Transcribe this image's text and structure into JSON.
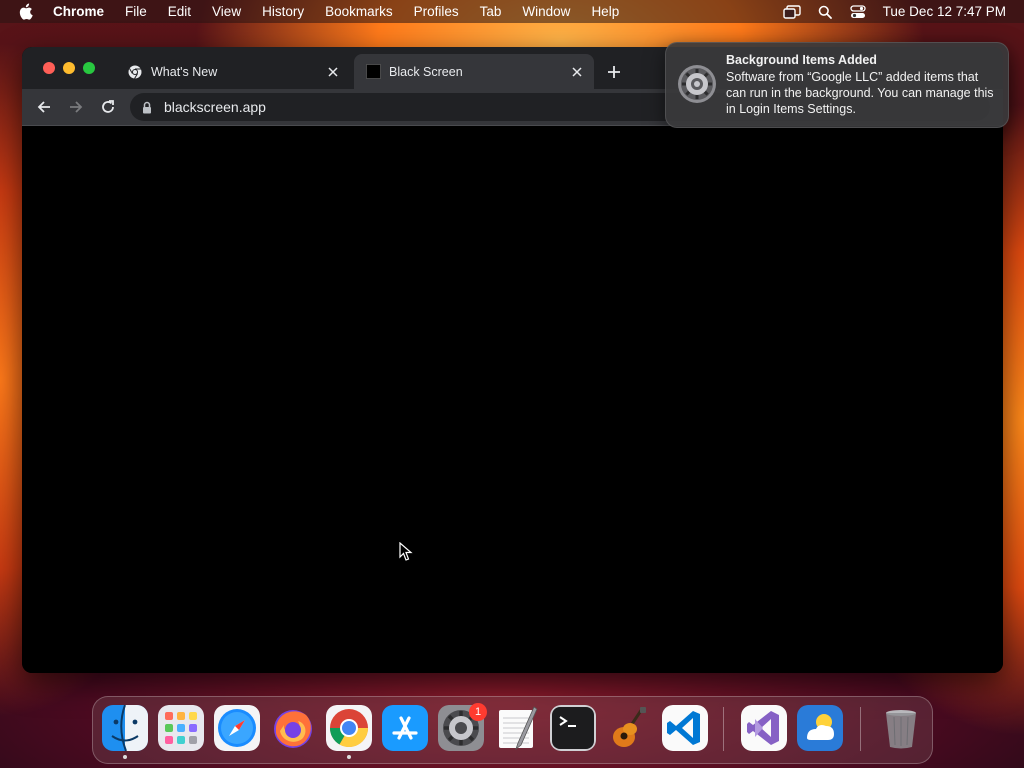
{
  "menubar": {
    "app_name": "Chrome",
    "items": [
      "File",
      "Edit",
      "View",
      "History",
      "Bookmarks",
      "Profiles",
      "Tab",
      "Window",
      "Help"
    ],
    "clock": "Tue Dec 12  7:47 PM",
    "status_icons": [
      "screen-mirroring-icon",
      "spotlight-search-icon",
      "control-center-icon"
    ]
  },
  "browser": {
    "tabs": [
      {
        "label": "What's New",
        "icon": "chrome-icon",
        "active": false
      },
      {
        "label": "Black Screen",
        "icon": "black-square-icon",
        "active": true
      }
    ],
    "url": "blackscreen.app"
  },
  "notification": {
    "title": "Background Items Added",
    "body": "Software from “Google LLC” added items that can run in the background. You can manage this in Login Items Settings.",
    "icon": "gear-icon"
  },
  "dock": {
    "apps": [
      {
        "name": "Finder",
        "icon": "finder-icon",
        "running": true
      },
      {
        "name": "Launchpad",
        "icon": "launchpad-icon",
        "running": false
      },
      {
        "name": "Safari",
        "icon": "safari-icon",
        "running": false
      },
      {
        "name": "Firefox",
        "icon": "firefox-icon",
        "running": false
      },
      {
        "name": "Google Chrome",
        "icon": "chrome-icon",
        "running": true
      },
      {
        "name": "App Store",
        "icon": "app-store-icon",
        "running": false
      },
      {
        "name": "System Settings",
        "icon": "settings-icon",
        "running": false,
        "badge": "1"
      },
      {
        "name": "TextEdit",
        "icon": "textedit-icon",
        "running": false
      },
      {
        "name": "Terminal",
        "icon": "terminal-icon",
        "running": false
      },
      {
        "name": "GarageBand",
        "icon": "garageband-icon",
        "running": false
      },
      {
        "name": "Visual Studio Code",
        "icon": "vscode-icon",
        "running": false
      },
      {
        "name": "Visual Studio",
        "icon": "visual-studio-icon",
        "running": false
      },
      {
        "name": "Weather",
        "icon": "weather-icon",
        "running": false
      },
      {
        "name": "Trash",
        "icon": "trash-icon",
        "running": false
      }
    ]
  }
}
